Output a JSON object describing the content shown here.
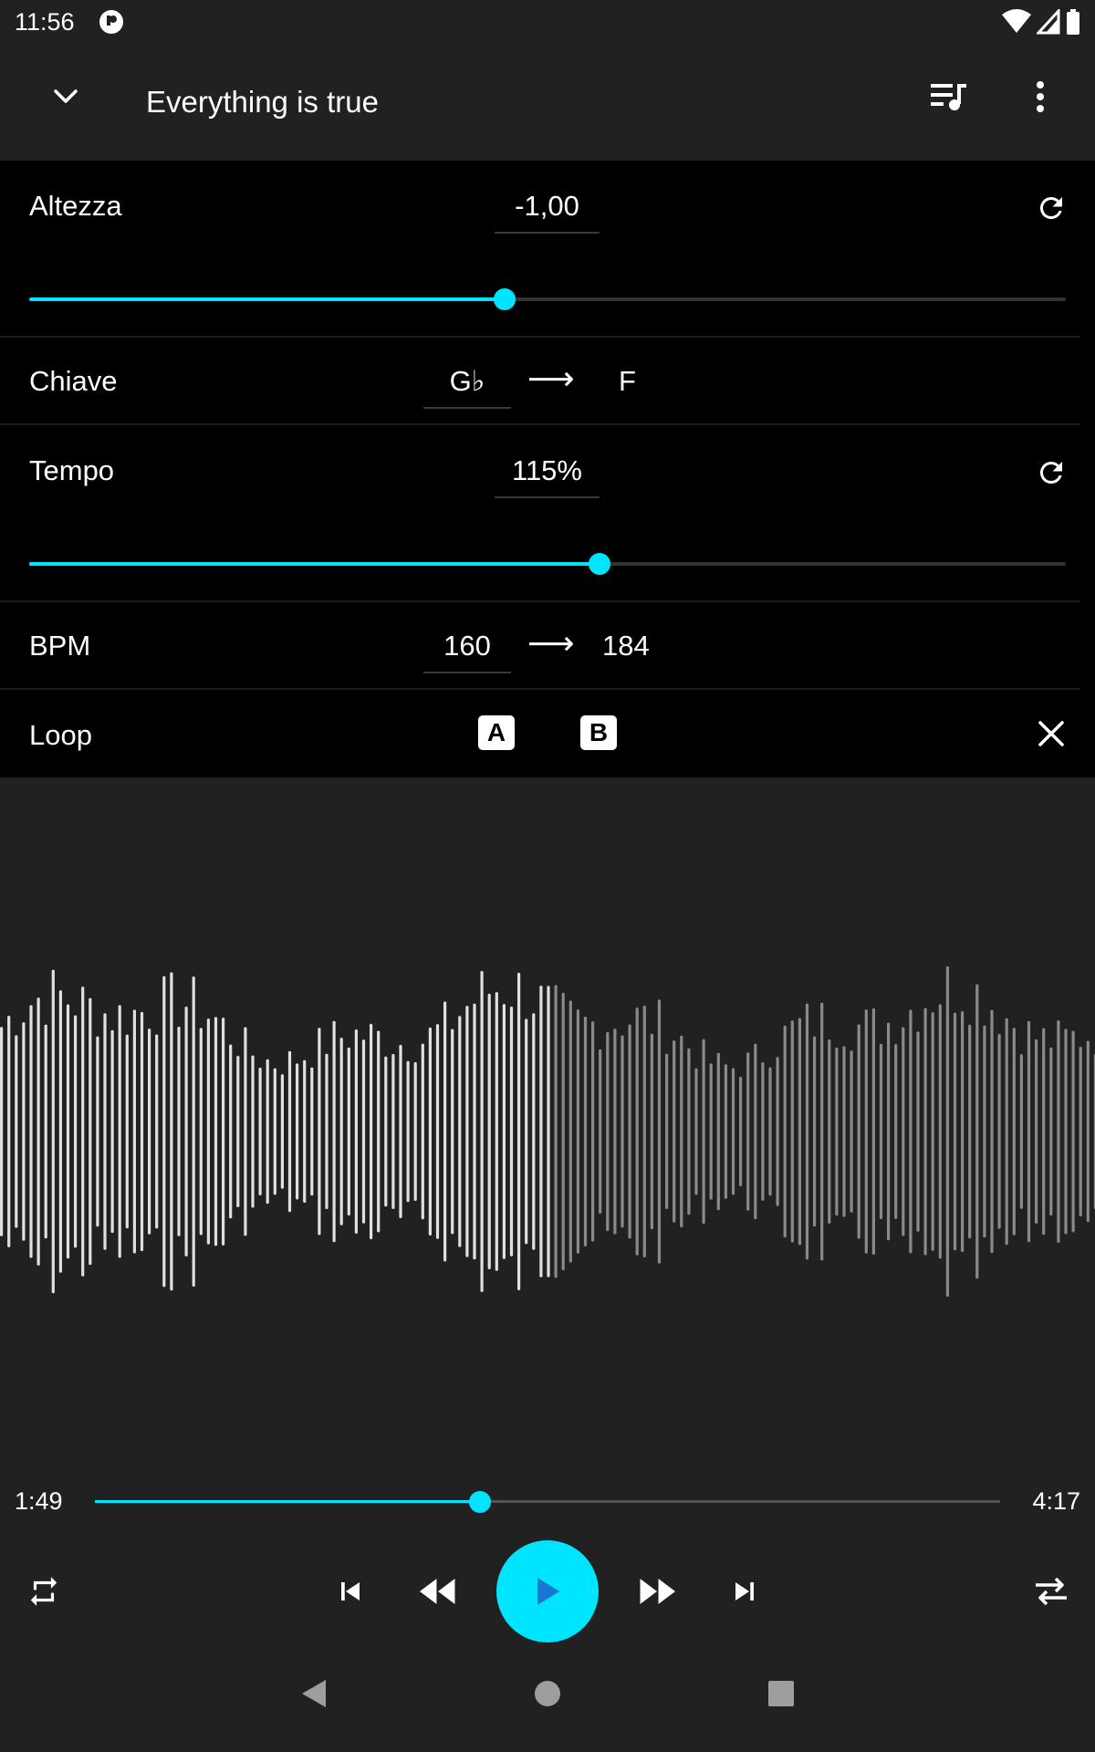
{
  "status_bar": {
    "time": "11:56"
  },
  "header": {
    "title": "Everything is true",
    "icons": [
      "chevron-down-icon",
      "queue-music-icon",
      "more-vert-icon"
    ]
  },
  "pitch": {
    "label": "Altezza",
    "value": "-1,00",
    "slider_fraction": 0.459
  },
  "key": {
    "label": "Chiave",
    "from": "G♭",
    "arrow": "⟶",
    "to": "F"
  },
  "tempo": {
    "label": "Tempo",
    "value": "115%",
    "slider_fraction": 0.55
  },
  "bpm": {
    "label": "BPM",
    "from": "160",
    "arrow": "⟶",
    "to": "184"
  },
  "loop": {
    "label": "Loop",
    "a_label": "A",
    "b_label": "B"
  },
  "playback": {
    "elapsed": "1:49",
    "total": "4:17",
    "progress_fraction": 0.425
  },
  "colors": {
    "accent": "#00e5ff",
    "background": "#212121",
    "panel": "#000000"
  }
}
